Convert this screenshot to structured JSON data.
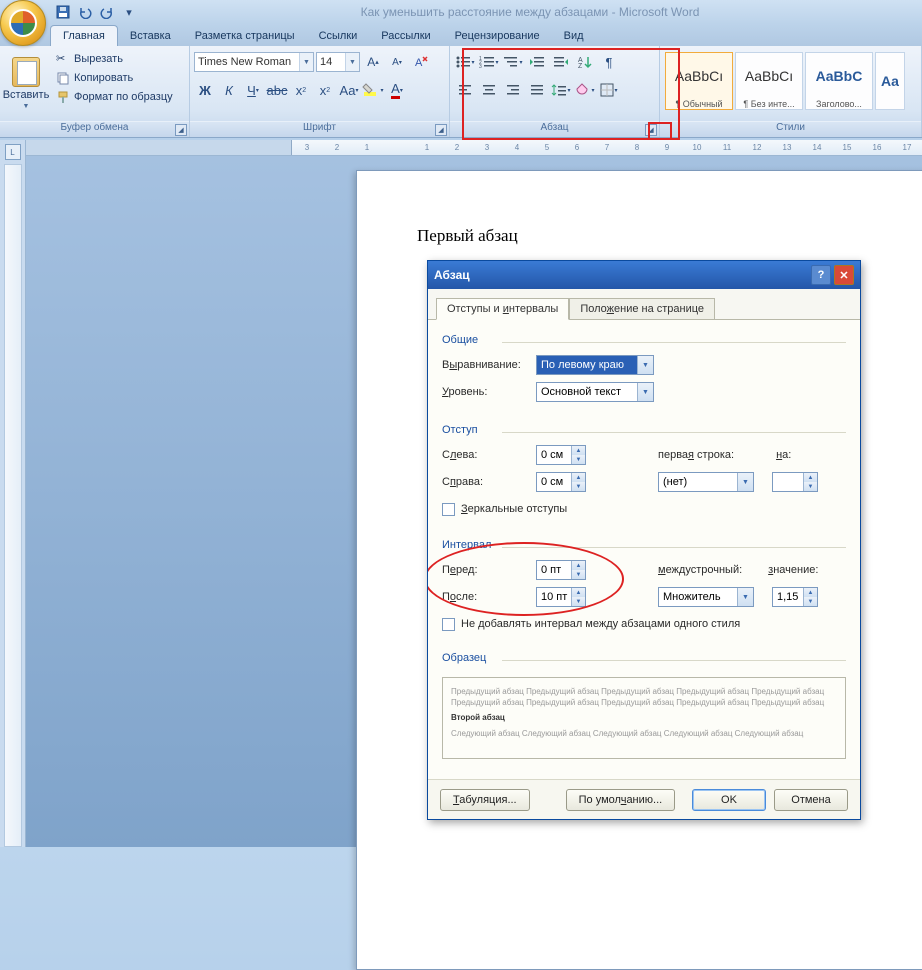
{
  "title": "Как уменьшить расстояние между абзацами - Microsoft Word",
  "tabs": {
    "home": "Главная",
    "insert": "Вставка",
    "layout": "Разметка страницы",
    "refs": "Ссылки",
    "mail": "Рассылки",
    "review": "Рецензирование",
    "view": "Вид"
  },
  "clipboard": {
    "paste": "Вставить",
    "cut": "Вырезать",
    "copy": "Копировать",
    "format": "Формат по образцу",
    "group": "Буфер обмена"
  },
  "font": {
    "name": "Times New Roman",
    "size": "14",
    "group": "Шрифт"
  },
  "paragraph": {
    "group": "Абзац"
  },
  "styles": {
    "group": "Стили",
    "s1": "¶ Обычный",
    "s2": "¶ Без инте...",
    "s3": "Заголово...",
    "p": "AaBbCı",
    "p2": "AaBbCı",
    "p3": "AaBbC",
    "p4": "Aa"
  },
  "doc": {
    "line1": "Первый абзац"
  },
  "dialog": {
    "title": "Абзац",
    "tab1": "Отступы и интервалы",
    "tab2": "Положение на странице",
    "general": "Общие",
    "align_label": "Выравнивание:",
    "align_value": "По левому краю",
    "level_label": "Уровень:",
    "level_value": "Основной текст",
    "indent": "Отступ",
    "left": "Слева:",
    "right": "Справа:",
    "zero_cm": "0 см",
    "first_line": "первая строка:",
    "first_value": "(нет)",
    "on": "на:",
    "mirror": "Зеркальные отступы",
    "spacing": "Интервал",
    "before": "Перед:",
    "after": "После:",
    "zero_pt": "0 пт",
    "ten_pt": "10 пт",
    "line_spacing": "междустрочный:",
    "value": "значение:",
    "multiplier": "Множитель",
    "mult_val": "1,15",
    "no_space": "Не добавлять интервал между абзацами одного стиля",
    "sample": "Образец",
    "prev_text": "Предыдущий абзац Предыдущий абзац Предыдущий абзац Предыдущий абзац Предыдущий абзац Предыдущий абзац Предыдущий абзац Предыдущий абзац Предыдущий абзац Предыдущий абзац",
    "sample_text": "Второй абзац",
    "next_text": "Следующий абзац Следующий абзац Следующий абзац Следующий абзац Следующий абзац",
    "tabs_btn": "Табуляция...",
    "default_btn": "По умолчанию...",
    "ok": "OK",
    "cancel": "Отмена"
  },
  "ruler": [
    "3",
    "2",
    "1",
    "",
    "1",
    "2",
    "3",
    "4",
    "5",
    "6",
    "7",
    "8",
    "9",
    "10",
    "11",
    "12",
    "13",
    "14",
    "15",
    "16",
    "17"
  ]
}
